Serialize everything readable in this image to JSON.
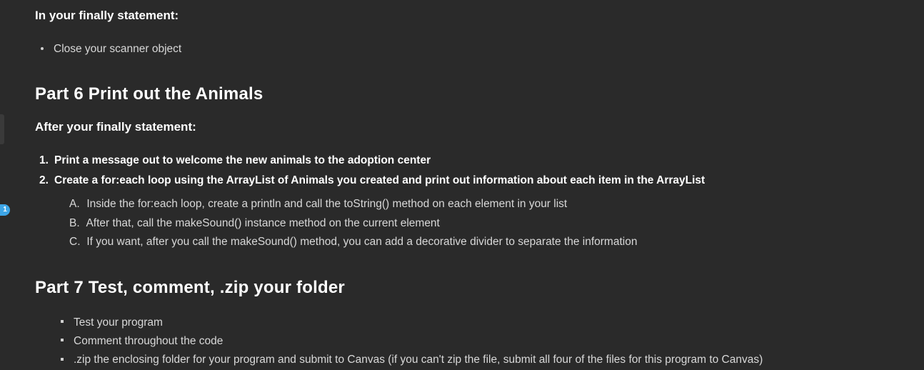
{
  "rail": {
    "badge": "1"
  },
  "intro_heading": "In your finally statement:",
  "intro_bullets": [
    "Close your scanner object"
  ],
  "part6": {
    "title": "Part 6 Print out the Animals",
    "sub": "After your finally statement:",
    "steps": [
      "Print a message out to welcome the new animals to the adoption center",
      "Create a for:each loop using the ArrayList of Animals you created and print out information about each item in the ArrayList"
    ],
    "substeps": [
      {
        "letter": "A.",
        "text": "Inside the for:each loop, create a println and call the toString() method on each element in your list"
      },
      {
        "letter": "B.",
        "text": "After that, call the makeSound() instance method on the current element"
      },
      {
        "letter": "C.",
        "text": "If you want, after you call the makeSound() method, you can add a decorative divider to separate the information"
      }
    ]
  },
  "part7": {
    "title": "Part 7 Test, comment, .zip your folder",
    "bullets": [
      "Test your program",
      "Comment throughout the code",
      ".zip the enclosing folder for your program and submit to Canvas (if you can't zip the file, submit all four of the files for this program to Canvas)"
    ]
  }
}
